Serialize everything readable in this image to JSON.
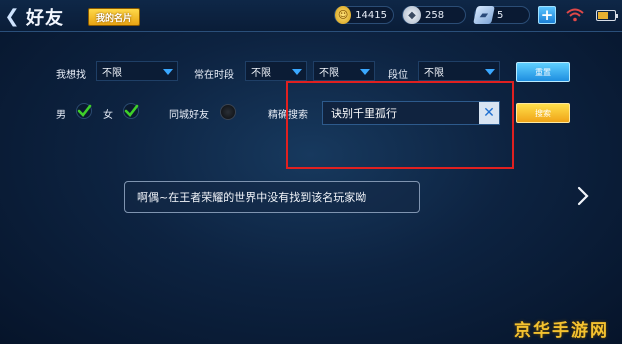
{
  "header": {
    "title": "好友",
    "my_card_label": "我的名片",
    "gold": "14415",
    "diamonds": "258",
    "tickets": "5",
    "add_symbol": "+"
  },
  "filters": {
    "want_find_label": "我想找",
    "want_find_value": "不限",
    "time_label": "常在时段",
    "time_value_1": "不限",
    "time_value_2": "不限",
    "rank_label": "段位",
    "rank_value": "不限",
    "reset_label": "重置",
    "male_label": "男",
    "female_label": "女",
    "male_checked": true,
    "female_checked": true,
    "same_city_label": "同城好友",
    "exact_search_label": "精确搜索",
    "search_value": "诀别千里孤行",
    "search_button_label": "搜索"
  },
  "result": {
    "message": "啊偶~在王者荣耀的世界中没有找到该名玩家呦"
  },
  "watermark": "京华手游网",
  "colors": {
    "accent_blue": "#1e8ee0",
    "accent_yellow": "#f0a418",
    "highlight_red": "#e02020",
    "check_green": "#3fcf2a"
  }
}
